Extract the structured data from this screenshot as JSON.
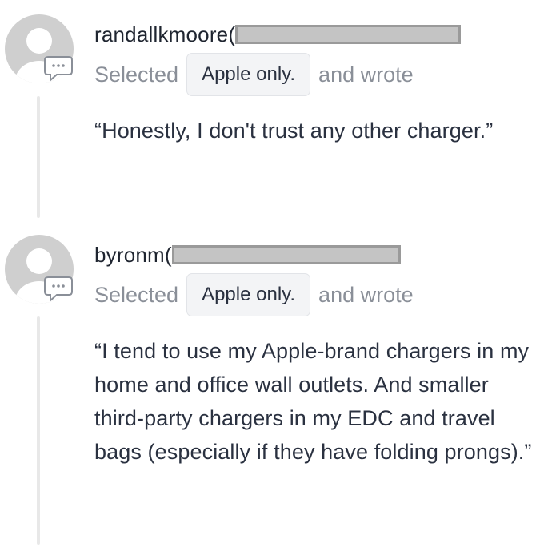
{
  "comments": [
    {
      "username": "randallkmoore(",
      "selected_prefix": "Selected",
      "choice": "Apple only.",
      "selected_suffix": "and wrote",
      "quote": "“Honestly, I don't trust any other charger.”"
    },
    {
      "username": "byronm(",
      "selected_prefix": "Selected",
      "choice": "Apple only.",
      "selected_suffix": "and wrote",
      "quote": "“I tend to use my Apple-brand chargers in my home and office wall outlets. And smaller third-party chargers in my EDC and travel bags (especially if they have folding prongs).”"
    }
  ],
  "icons": {
    "avatar": "default-avatar-icon",
    "comment": "comment-bubble-icon"
  },
  "colors": {
    "avatar_gray": "#cfcfcf",
    "redaction_fill": "#c4c4c4",
    "redaction_border": "#9a9a9a",
    "muted_text": "#8a8f98"
  }
}
